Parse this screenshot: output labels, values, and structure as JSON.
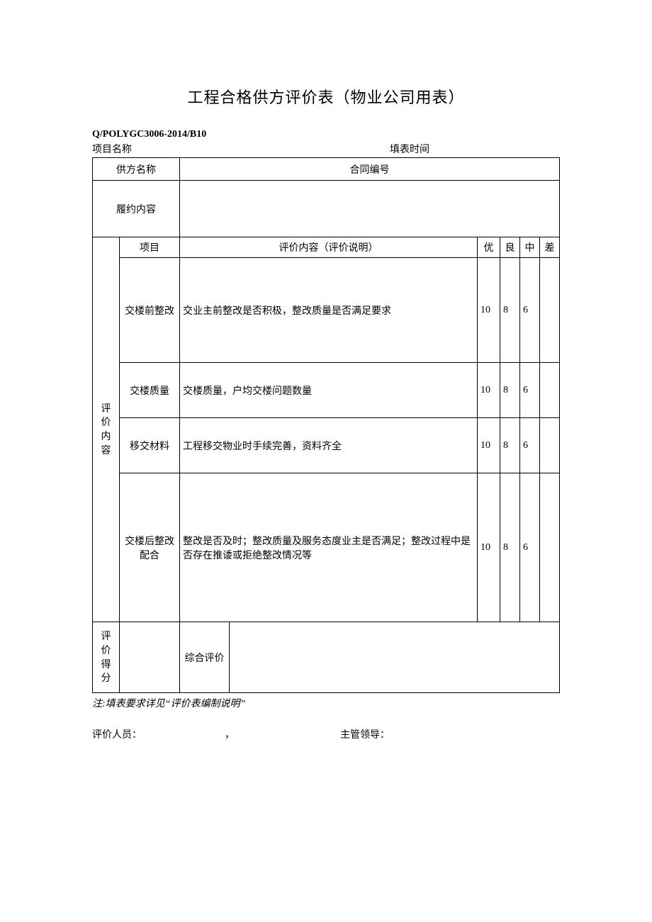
{
  "title": "工程合格供方评价表（物业公司用表）",
  "doc_code": "Q/POLYGC3006-2014/B10",
  "meta": {
    "project_label": "项目名称",
    "date_label": "填表时间"
  },
  "rows": {
    "supplier_label": "供方名称",
    "contract_label": "合同编号",
    "contract_value": "",
    "content_label": "履约内容",
    "content_value": ""
  },
  "header": {
    "item": "项目",
    "desc": "评价内容（评价说明）",
    "g1": "优",
    "g2": "良",
    "g3": "中",
    "g4": "差"
  },
  "side_eval": "评价内容",
  "evals": [
    {
      "item": "交楼前整改",
      "desc": "交业主前整改是否积极，整改质量是否满足要求",
      "g1": "10",
      "g2": "8",
      "g3": "6",
      "g4": ""
    },
    {
      "item": "交楼质量",
      "desc": "交楼质量，户均交楼问题数量",
      "g1": "10",
      "g2": "8",
      "g3": "6",
      "g4": ""
    },
    {
      "item": "移交材料",
      "desc": "工程移交物业时手续完善，资料齐全",
      "g1": "10",
      "g2": "8",
      "g3": "6",
      "g4": ""
    },
    {
      "item": "交楼后整改配合",
      "desc": "整改是否及时；整改质量及服务态度业主是否满足；整改过程中是否存在推诿或拒绝整改情况等",
      "g1": "10",
      "g2": "8",
      "g3": "6",
      "g4": ""
    }
  ],
  "score": {
    "side": "评价得分",
    "overall_label": "综合评价",
    "overall_value": ""
  },
  "note": "注:填表要求详见“评价表编制说明”",
  "signatures": {
    "evaluator_label": "评价人员：",
    "sep": "，",
    "leader_label": "主管领导："
  }
}
